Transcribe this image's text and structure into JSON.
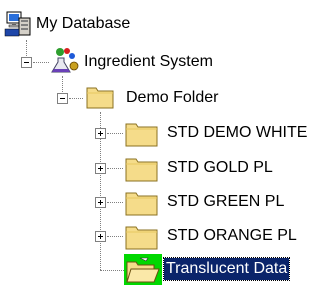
{
  "tree": {
    "root": {
      "label": "My Database",
      "icon": "database-icon"
    },
    "system": {
      "label": "Ingredient System",
      "icon": "ingredient-system-icon",
      "expanded": true
    },
    "folder": {
      "label": "Demo Folder",
      "icon": "folder-open-icon",
      "expanded": true
    },
    "items": [
      {
        "label": "STD DEMO WHITE",
        "icon": "folder-icon",
        "expanded": false
      },
      {
        "label": "STD GOLD PL",
        "icon": "folder-icon",
        "expanded": false
      },
      {
        "label": "STD GREEN PL",
        "icon": "folder-icon",
        "expanded": false
      },
      {
        "label": "STD ORANGE PL",
        "icon": "folder-icon",
        "expanded": false
      }
    ],
    "selected": {
      "label": "Translucent Data",
      "icon": "open-folder-green-icon"
    }
  },
  "colors": {
    "selection_bg": "#0a246a",
    "selection_fg": "#ffffff",
    "folder": "#f5dc8a",
    "connector": "#808080"
  }
}
